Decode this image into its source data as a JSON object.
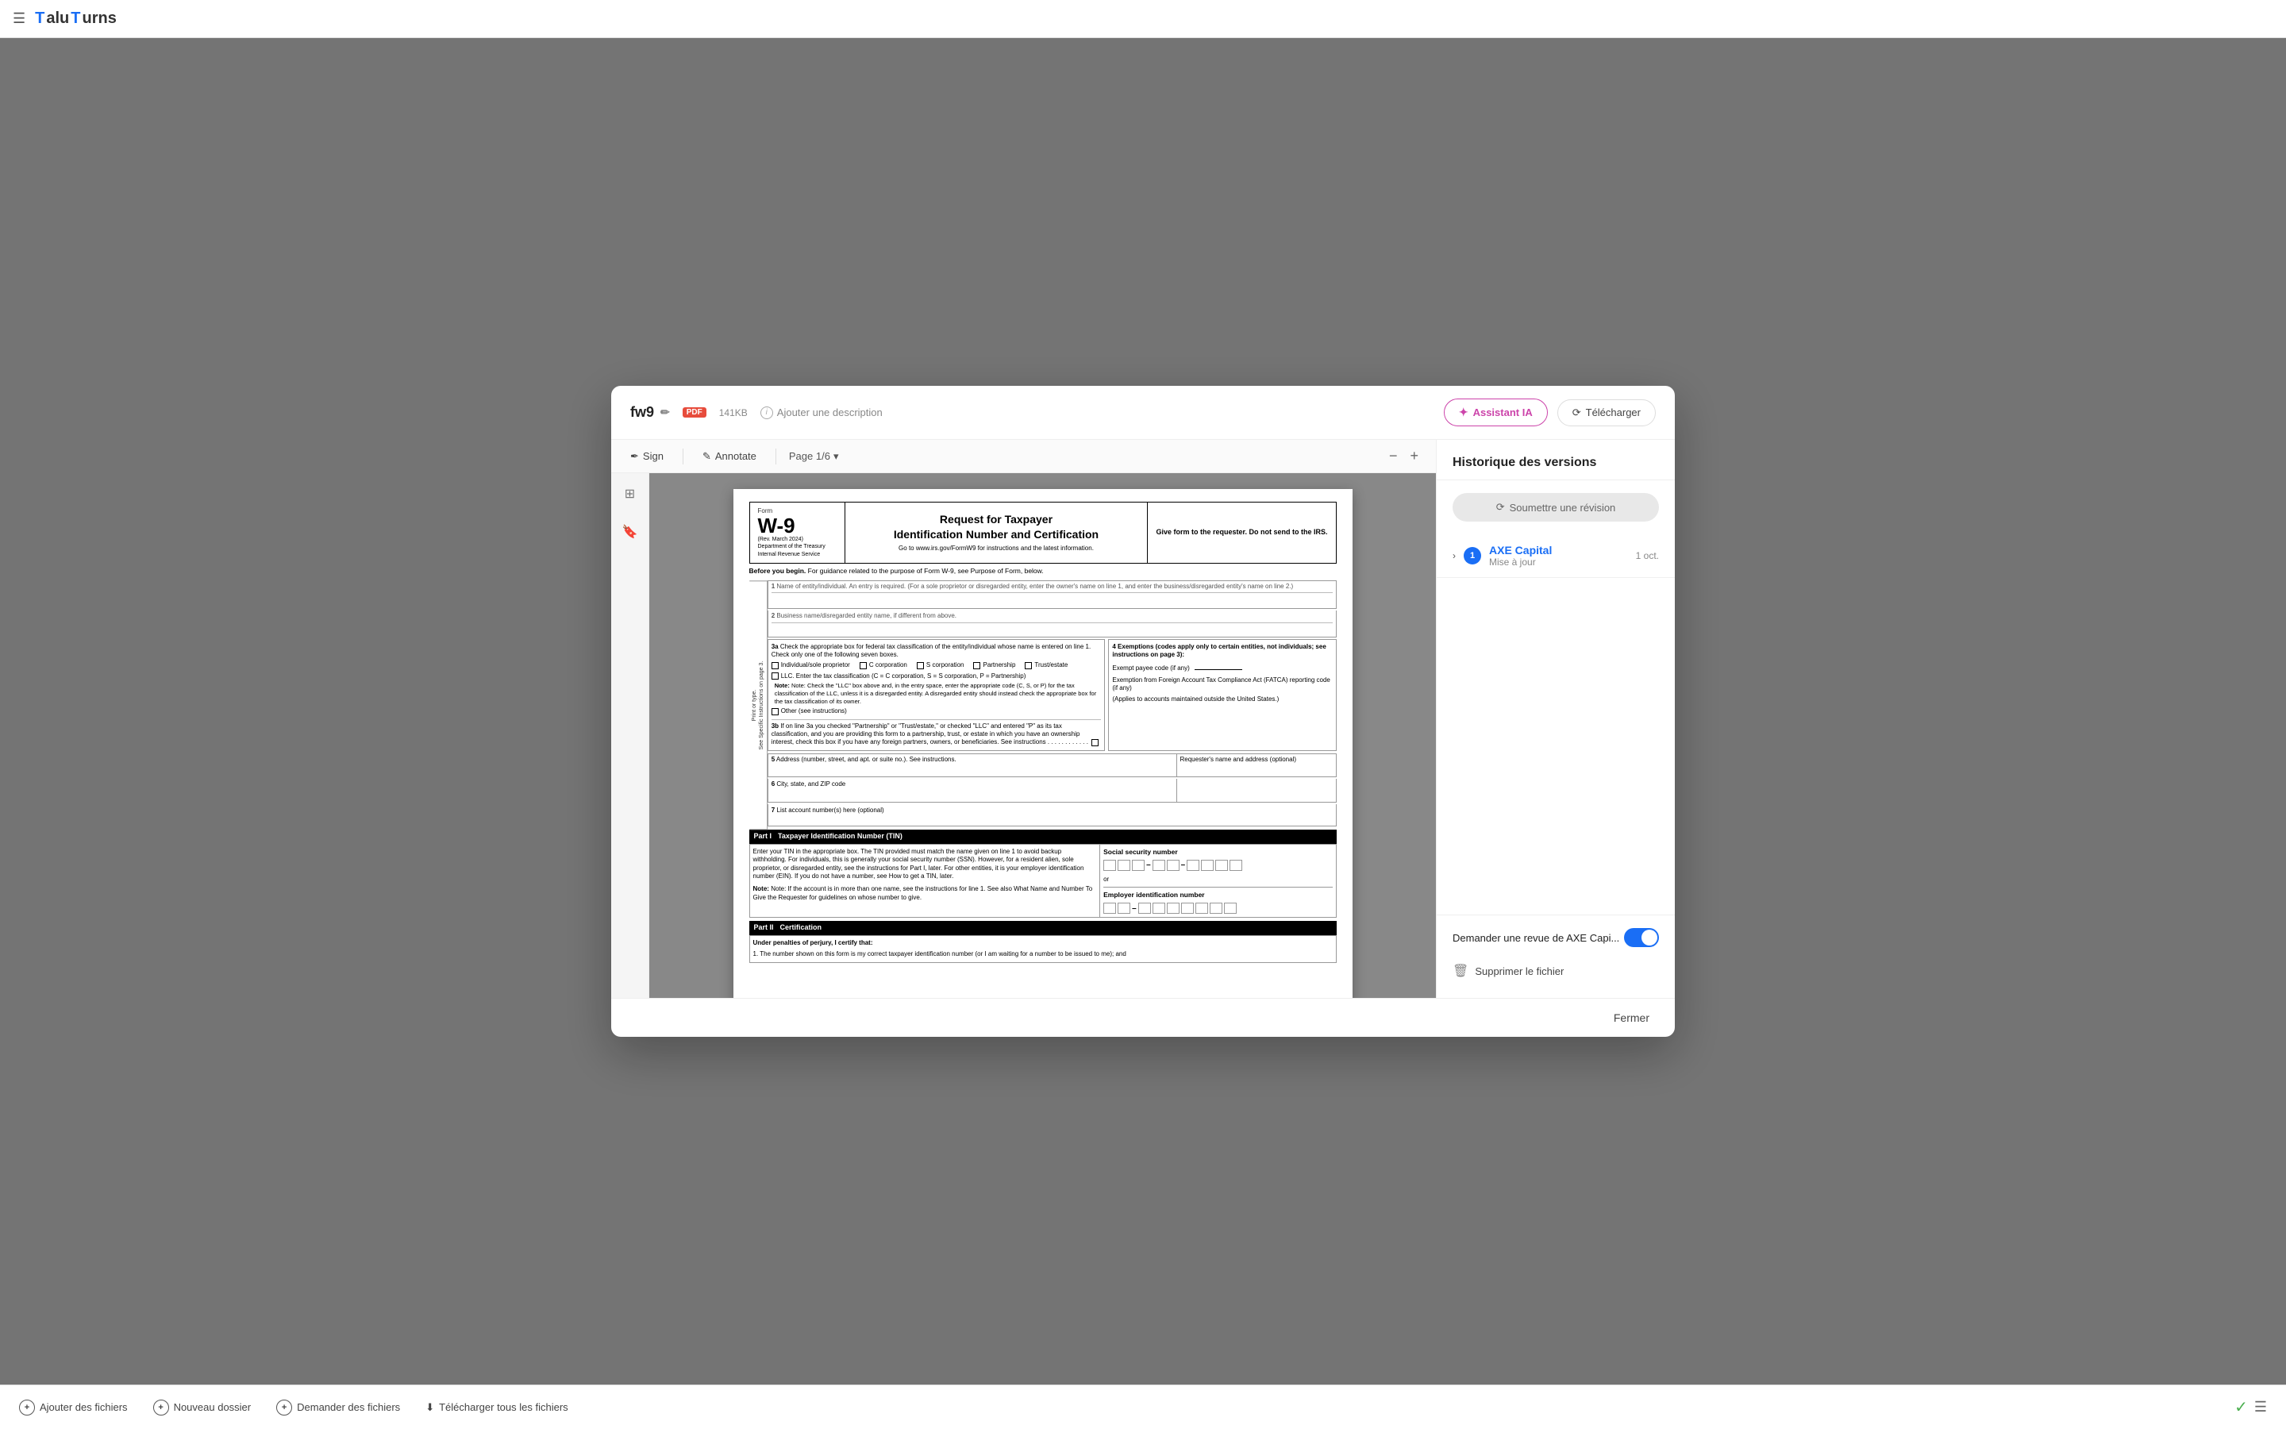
{
  "app": {
    "logo": "TaluTurns",
    "logo_parts": [
      "T",
      "alu",
      "T",
      "urns"
    ]
  },
  "modal": {
    "title": "fw9",
    "file_type": "PDF",
    "file_size": "141KB",
    "add_description": "Ajouter une description",
    "ai_button": "Assistant IA",
    "download_button": "Télécharger"
  },
  "pdf_toolbar": {
    "sign_label": "Sign",
    "annotate_label": "Annotate",
    "page_label": "Page 1/6",
    "zoom_in": "+",
    "zoom_out": "−"
  },
  "right_panel": {
    "title": "Historique des versions",
    "submit_btn": "Soumettre une révision",
    "version_number": "1",
    "version_name": "AXE Capital",
    "version_meta": "Mise à jour",
    "version_date": "1 oct.",
    "review_label": "Demander une revue de AXE Capi...",
    "delete_label": "Supprimer le fichier"
  },
  "bottom_bar": {
    "add_files": "Ajouter des fichiers",
    "new_folder": "Nouveau dossier",
    "request_files": "Demander des fichiers",
    "download_all": "Télécharger tous les fichiers"
  },
  "close_button": "Fermer",
  "w9": {
    "form_label": "Form",
    "form_number": "W-9",
    "rev_date": "(Rev. March 2024)",
    "dept": "Department of the Treasury",
    "irs": "Internal Revenue Service",
    "main_title": "Request for Taxpayer",
    "sub_title": "Identification Number and Certification",
    "url_text": "Go to www.irs.gov/FormW9 for instructions and the latest information.",
    "give_form": "Give form to the requester. Do not send to the IRS.",
    "before_begin": "Before you begin.",
    "before_text": " For guidance related to the purpose of Form W-9, see Purpose of Form, below.",
    "field1_num": "1",
    "field1_label": "Name of entity/individual. An entry is required. (For a sole proprietor or disregarded entity, enter the owner's name on line 1, and enter the business/disregarded entity's name on line 2.)",
    "field2_num": "2",
    "field2_label": "Business name/disregarded entity name, if different from above.",
    "field3a_num": "3a",
    "field3a_label": "Check the appropriate box for federal tax classification of the entity/individual whose name is entered on line 1. Check only one of the following seven boxes.",
    "check_options": [
      "Individual/sole proprietor",
      "C corporation",
      "S corporation",
      "Partnership",
      "Trust/estate"
    ],
    "llc_label": "LLC. Enter the tax classification (C = C corporation, S = S corporation, P = Partnership)",
    "llc_note": "Note: Check the \"LLC\" box above and, in the entry space, enter the appropriate code (C, S, or P) for the tax classification of the LLC, unless it is a disregarded entity. A disregarded entity should instead check the appropriate box for the tax classification of its owner.",
    "other_label": "Other (see instructions)",
    "field3b_num": "3b",
    "field3b_text": "If on line 3a you checked \"Partnership\" or \"Trust/estate,\" or checked \"LLC\" and entered \"P\" as its tax classification, and you are providing this form to a partnership, trust, or estate in which you have an ownership interest, check this box if you have any foreign partners, owners, or beneficiaries. See instructions . . . . . . . . . . . .",
    "exemption_title": "4 Exemptions (codes apply only to certain entities, not individuals; see instructions on page 3):",
    "exempt_payee": "Exempt payee code (if any)",
    "fatca_label": "Exemption from Foreign Account Tax Compliance Act (FATCA) reporting code (if any)",
    "fatca_note": "(Applies to accounts maintained outside the United States.)",
    "field5_num": "5",
    "field5_label": "Address (number, street, and apt. or suite no.). See instructions.",
    "requester_label": "Requester's name and address (optional)",
    "field6_num": "6",
    "field6_label": "City, state, and ZIP code",
    "field7_num": "7",
    "field7_label": "List account number(s) here (optional)",
    "part1_label": "Part I",
    "part1_title": "Taxpayer Identification Number (TIN)",
    "part1_text": "Enter your TIN in the appropriate box. The TIN provided must match the name given on line 1 to avoid backup withholding. For individuals, this is generally your social security number (SSN). However, for a resident alien, sole proprietor, or disregarded entity, see the instructions for Part I, later. For other entities, it is your employer identification number (EIN). If you do not have a number, see How to get a TIN, later.",
    "part1_note": "Note: If the account is in more than one name, see the instructions for line 1. See also What Name and Number To Give the Requester for guidelines on whose number to give.",
    "ssn_label": "Social security number",
    "ein_label": "Employer identification number",
    "part2_label": "Part II",
    "part2_title": "Certification",
    "cert_label": "Under penalties of perjury, I certify that:",
    "cert_text1": "1. The number shown on this form is my correct taxpayer identification number (or I am waiting for a number to be issued to me); and"
  }
}
